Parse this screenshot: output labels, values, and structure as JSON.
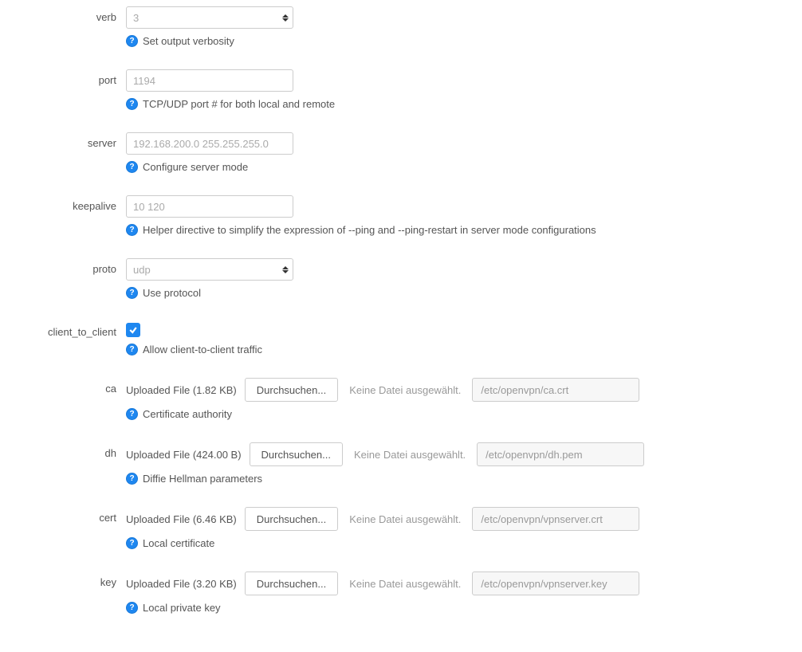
{
  "fields": {
    "verb": {
      "label": "verb",
      "value": "3",
      "hint": "Set output verbosity"
    },
    "port": {
      "label": "port",
      "value": "1194",
      "hint": "TCP/UDP port # for both local and remote"
    },
    "server": {
      "label": "server",
      "value": "192.168.200.0 255.255.255.0",
      "hint": "Configure server mode"
    },
    "keepalive": {
      "label": "keepalive",
      "value": "10 120",
      "hint": "Helper directive to simplify the expression of --ping and --ping-restart in server mode configurations"
    },
    "proto": {
      "label": "proto",
      "value": "udp",
      "hint": "Use protocol"
    },
    "client_to_client": {
      "label": "client_to_client",
      "hint": "Allow client-to-client traffic"
    },
    "ca": {
      "label": "ca",
      "uploaded": "Uploaded File (1.82 KB)",
      "browse": "Durchsuchen...",
      "nofile": "Keine Datei ausgewählt.",
      "path": "/etc/openvpn/ca.crt",
      "hint": "Certificate authority"
    },
    "dh": {
      "label": "dh",
      "uploaded": "Uploaded File (424.00 B)",
      "browse": "Durchsuchen...",
      "nofile": "Keine Datei ausgewählt.",
      "path": "/etc/openvpn/dh.pem",
      "hint": "Diffie Hellman parameters"
    },
    "cert": {
      "label": "cert",
      "uploaded": "Uploaded File (6.46 KB)",
      "browse": "Durchsuchen...",
      "nofile": "Keine Datei ausgewählt.",
      "path": "/etc/openvpn/vpnserver.crt",
      "hint": "Local certificate"
    },
    "key": {
      "label": "key",
      "uploaded": "Uploaded File (3.20 KB)",
      "browse": "Durchsuchen...",
      "nofile": "Keine Datei ausgewählt.",
      "path": "/etc/openvpn/vpnserver.key",
      "hint": "Local private key"
    }
  }
}
